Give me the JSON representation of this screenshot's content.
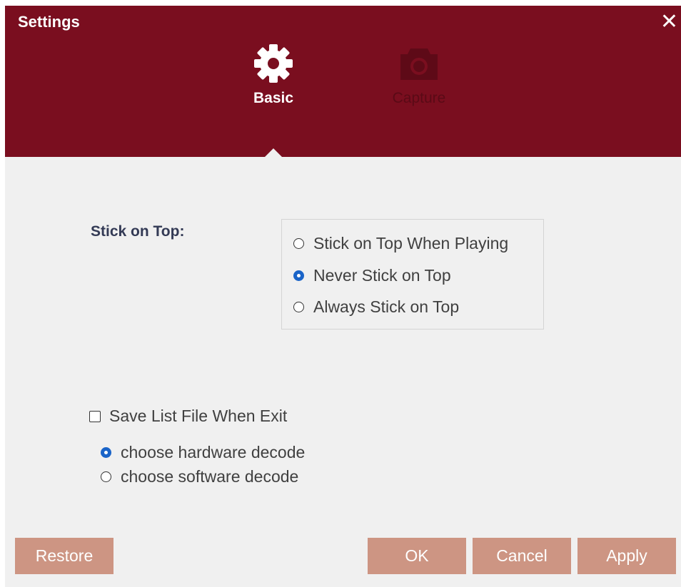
{
  "window": {
    "title": "Settings",
    "close_label": "✕"
  },
  "tabs": [
    {
      "label": "Basic",
      "icon": "gear-icon",
      "active": true
    },
    {
      "label": "Capture",
      "icon": "camera-icon",
      "active": false
    }
  ],
  "stick_on_top": {
    "label": "Stick on Top:",
    "options": [
      {
        "label": "Stick on Top When Playing",
        "checked": false
      },
      {
        "label": "Never Stick on Top",
        "checked": true
      },
      {
        "label": "Always Stick on Top",
        "checked": false
      }
    ]
  },
  "save_list": {
    "label": "Save List File When Exit",
    "checked": false
  },
  "decode": {
    "options": [
      {
        "label": "choose hardware decode",
        "checked": true
      },
      {
        "label": "choose software decode",
        "checked": false
      }
    ]
  },
  "buttons": {
    "restore": "Restore",
    "ok": "OK",
    "cancel": "Cancel",
    "apply": "Apply"
  },
  "colors": {
    "header": "#7a0e1f",
    "button": "#cd9583",
    "radio_checked": "#1a64c8"
  }
}
